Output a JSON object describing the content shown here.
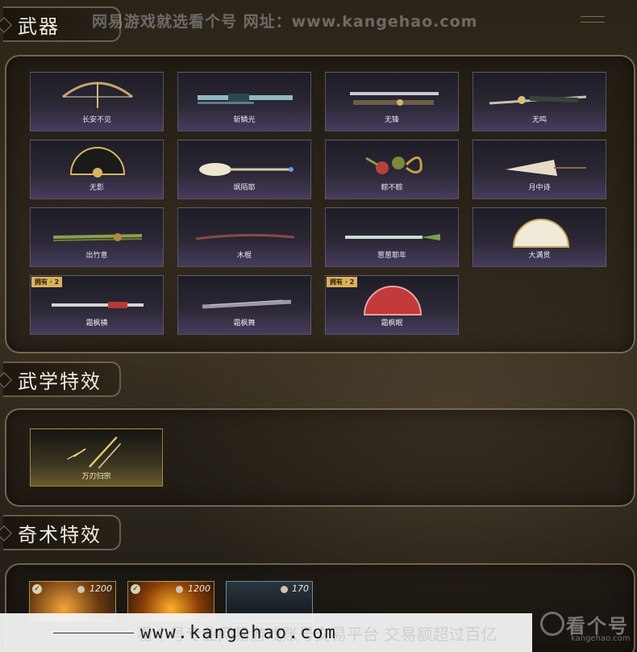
{
  "header": {
    "section_title": "武器",
    "watermark": "网易游戏就选看个号   网址：www.kangehao.com"
  },
  "weapons": [
    {
      "name": "长安不见",
      "badge": ""
    },
    {
      "name": "斩鳞光",
      "badge": ""
    },
    {
      "name": "无锋",
      "badge": ""
    },
    {
      "name": "无鸣",
      "badge": ""
    },
    {
      "name": "无影",
      "badge": ""
    },
    {
      "name": "飒陌耶",
      "badge": ""
    },
    {
      "name": "粽不粽",
      "badge": ""
    },
    {
      "name": "月中诗",
      "badge": ""
    },
    {
      "name": "出竹意",
      "badge": ""
    },
    {
      "name": "木棍",
      "badge": ""
    },
    {
      "name": "葱葱耶年",
      "badge": ""
    },
    {
      "name": "大满贯",
      "badge": ""
    },
    {
      "name": "霜枫横",
      "badge": "拥有 · 2"
    },
    {
      "name": "霜枫舞",
      "badge": ""
    },
    {
      "name": "霜枫眠",
      "badge": "拥有 · 2"
    }
  ],
  "martial_effects": {
    "section_title": "武学特效",
    "items": [
      {
        "name": "万刃归宗"
      }
    ]
  },
  "mystic_effects": {
    "section_title": "奇术特效",
    "items": [
      {
        "price": "1200",
        "owned": true
      },
      {
        "price": "1200",
        "owned": true
      },
      {
        "price": "170",
        "owned": false
      }
    ]
  },
  "footer": {
    "url": "www.kangehao.com",
    "faint_text": "看个号专业网易游戏账号交易平台 交易额超过百亿",
    "logo_text": "看个号",
    "logo_sub": "kangehao.com"
  }
}
